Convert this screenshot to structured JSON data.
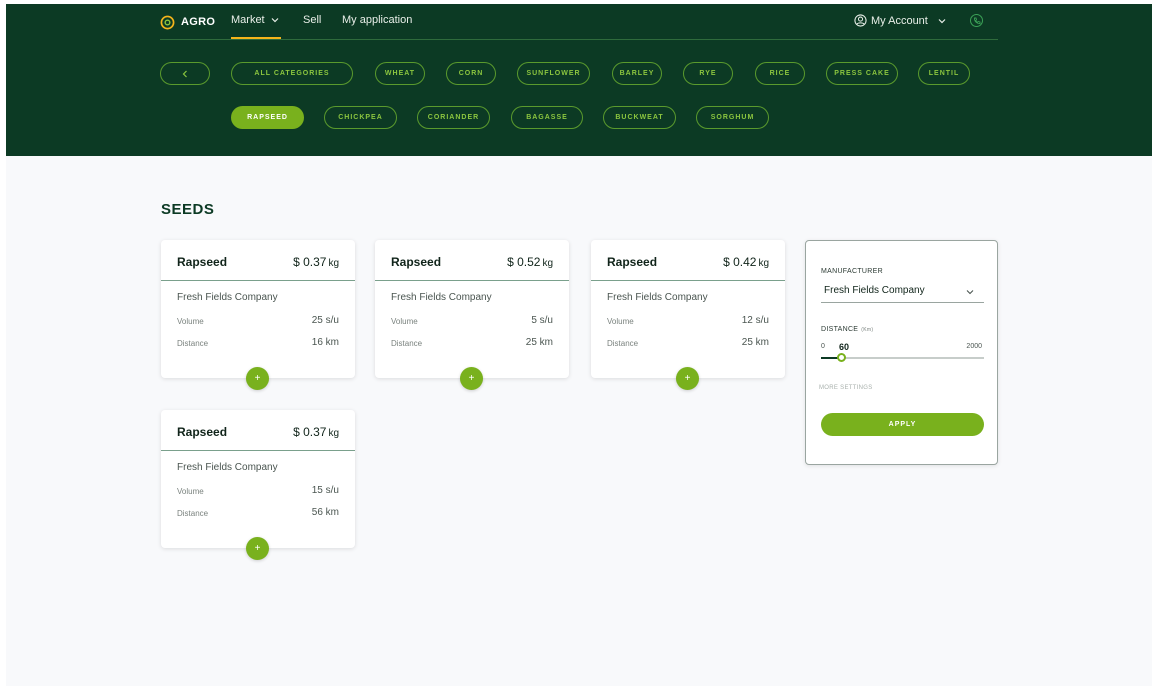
{
  "brand": {
    "name": "AGRO",
    "accent": "#f5b51b",
    "header_bg": "#0c3a24",
    "green": "#79b11d"
  },
  "nav": {
    "market": "Market",
    "sell": "Sell",
    "my_application": "My application",
    "account": "My Account"
  },
  "categories": {
    "back_icon": "chevron-left-icon",
    "row1": [
      "ALL CATEGORIES",
      "WHEAT",
      "CORN",
      "SUNFLOWER",
      "BARLEY",
      "RYE",
      "RICE",
      "PRESS CAKE",
      "LENTIL"
    ],
    "row2": [
      "RAPSEED",
      "CHICKPEA",
      "CORIANDER",
      "BAGASSE",
      "BUCKWEAT",
      "SORGHUM"
    ],
    "active": "RAPSEED"
  },
  "section": {
    "title": "SEEDS"
  },
  "cards": [
    {
      "name": "Rapseed",
      "price": "$ 0.37",
      "unit": "kg",
      "company": "Fresh Fields Company",
      "volume_label": "Volume",
      "volume": "25 s/u",
      "distance_label": "Distance",
      "distance": "16 km",
      "add": "+"
    },
    {
      "name": "Rapseed",
      "price": "$ 0.52",
      "unit": "kg",
      "company": "Fresh Fields Company",
      "volume_label": "Volume",
      "volume": "5 s/u",
      "distance_label": "Distance",
      "distance": "25 km",
      "add": "+"
    },
    {
      "name": "Rapseed",
      "price": "$ 0.42",
      "unit": "kg",
      "company": "Fresh Fields Company",
      "volume_label": "Volume",
      "volume": "12 s/u",
      "distance_label": "Distance",
      "distance": "25 km",
      "add": "+"
    },
    {
      "name": "Rapseed",
      "price": "$ 0.37",
      "unit": "kg",
      "company": "Fresh Fields Company",
      "volume_label": "Volume",
      "volume": "15 s/u",
      "distance_label": "Distance",
      "distance": "56 km",
      "add": "+"
    }
  ],
  "filter": {
    "manufacturer_label": "MANUFACTURER",
    "manufacturer_value": "Fresh Fields Company",
    "distance_label": "DISTANCE",
    "distance_unit": "(Km)",
    "distance_min": "0",
    "distance_max": "2000",
    "distance_value": "60",
    "more_settings": "MORE SETTINGS",
    "apply": "APPLY"
  }
}
